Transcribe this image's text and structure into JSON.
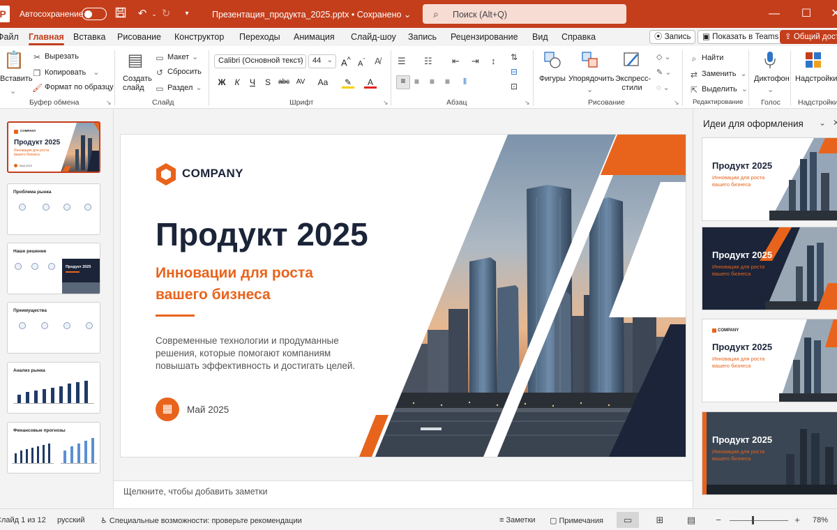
{
  "titlebar": {
    "autosave_label": "Автосохранение",
    "document_title": "Презентация_продукта_2025.pptx • Сохранено ⌄",
    "search_placeholder": "Поиск (Alt+Q)"
  },
  "tabs": [
    "Файл",
    "Главная",
    "Вставка",
    "Рисование",
    "Конструктор",
    "Переходы",
    "Анимация",
    "Слайд-шоу",
    "Запись",
    "Рецензирование",
    "Вид",
    "Справка"
  ],
  "tabs_active": "Главная",
  "top_buttons": {
    "record": "Запись",
    "teams": "Показать в Teams",
    "share": "Общий доступ"
  },
  "ribbon": {
    "clipboard": {
      "paste": "Вставить",
      "cut": "Вырезать",
      "copy": "Копировать",
      "format_painter": "Формат по образцу",
      "label": "Буфер обмена"
    },
    "slides": {
      "new_slide": "Создать слайд",
      "layout": "Макет",
      "reset": "Сбросить",
      "section": "Раздел",
      "label": "Слайд"
    },
    "font": {
      "font_name": "Calibri (Основной текст)",
      "font_size": "44",
      "bold": "Ж",
      "italic": "К",
      "underline": "Ч",
      "strike": "S",
      "strike2": "abc",
      "spacing": "AV",
      "case": "Aa",
      "label": "Шрифт"
    },
    "paragraph": {
      "label": "Абзац"
    },
    "drawing": {
      "shapes": "Фигуры",
      "arrange": "Упорядочить",
      "quick_styles": "Экспресс-стили",
      "label": "Рисование"
    },
    "editing": {
      "find": "Найти",
      "replace": "Заменить",
      "select": "Выделить",
      "label": "Редактирование"
    },
    "voice": {
      "dictate": "Диктофон",
      "label": "Голос"
    },
    "addins": {
      "addins": "Надстройки",
      "label": "Надстройки"
    }
  },
  "thumbnails": [
    {
      "title": "Продукт 2025",
      "company": "COMPANY",
      "subtitle": "Инновации для роста вашего бизнеса",
      "date": "Май 2025"
    },
    {
      "title": "Проблема рынка"
    },
    {
      "title": "Наше решение",
      "card_title": "Продукт 2025"
    },
    {
      "title": "Преимущества"
    },
    {
      "title": "Анализ рынка"
    },
    {
      "title": "Финансовые прогнозы"
    }
  ],
  "slide": {
    "company": "COMPANY",
    "title": "Продукт 2025",
    "subtitle": "Инновации для роста вашего бизнеса",
    "description": "Современные технологии и продуманные решения, которые помогают компаниям повышать эффективность и достигать целей.",
    "date": "Май 2025"
  },
  "notes_placeholder": "Щелкните, чтобы добавить заметки",
  "designer": {
    "title": "Идеи для оформления",
    "cards": [
      {
        "title": "Продукт 2025",
        "subtitle": "Инновации для роста вашего бизнеса"
      },
      {
        "title": "Продукт 2025",
        "subtitle": "Инновации для роста вашего бизнеса"
      },
      {
        "title": "Продукт 2025",
        "subtitle": "Инновации для роста вашего бизнеса",
        "company": "COMPANY"
      },
      {
        "title": "Продукт 2025",
        "subtitle": "Инновации для роста вашего бизнеса"
      }
    ]
  },
  "status": {
    "slide_counter": "Слайд 1 из 12",
    "language": "русский",
    "accessibility": "Специальные возможности: проверьте рекомендации",
    "notes": "Заметки",
    "comments": "Примечания",
    "zoom": "78%"
  },
  "colors": {
    "brand": "#c43e1c",
    "accent": "#e8641c",
    "navy": "#1b2438"
  }
}
